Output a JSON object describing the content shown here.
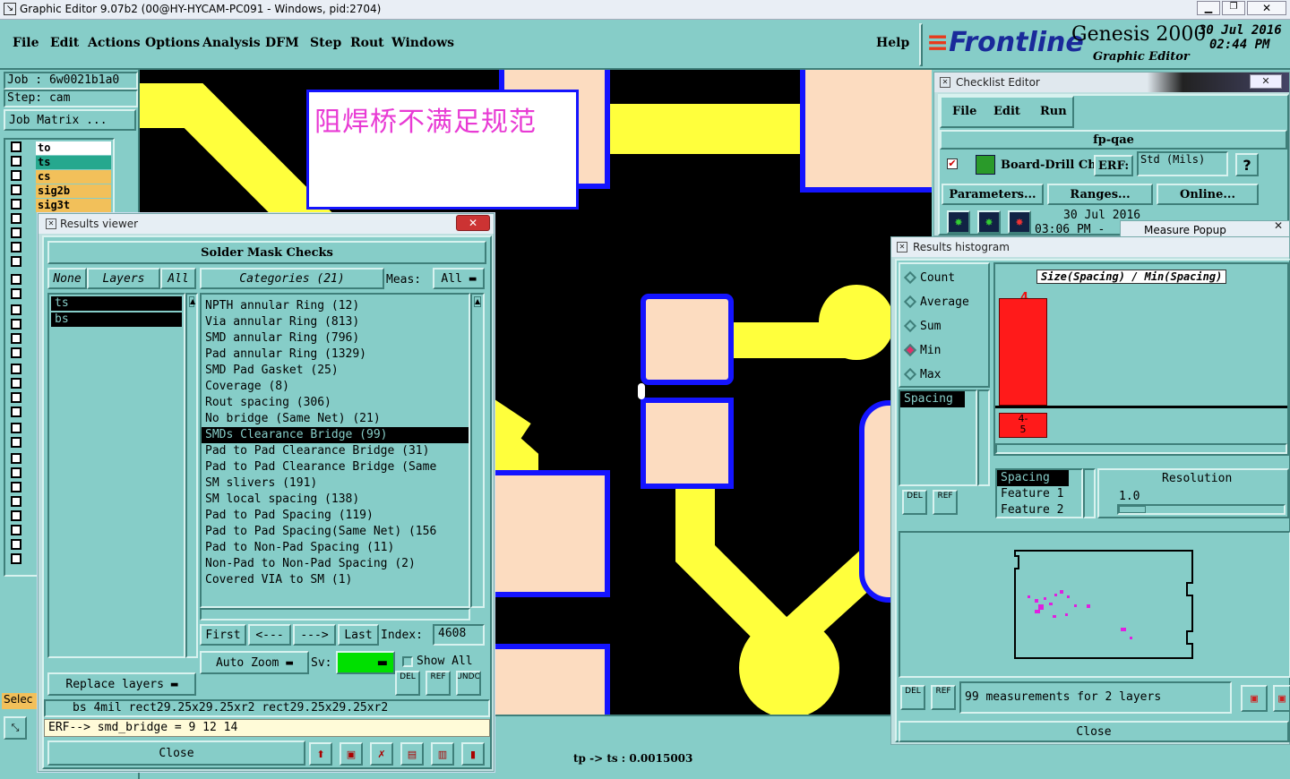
{
  "titlebar": {
    "title": "Graphic Editor 9.07b2 (00@HY-HYCAM-PC091 - Windows, pid:2704)"
  },
  "menu": {
    "items": [
      "File",
      "Edit",
      "Actions",
      "Options",
      "Analysis",
      "DFM",
      "Step",
      "Rout",
      "Windows"
    ],
    "help": "Help"
  },
  "brand": {
    "logo": "Frontline",
    "product": "Genesis 2000",
    "subtitle": "Graphic Editor",
    "date": "30 Jul 2016",
    "time": "02:44 PM"
  },
  "job": {
    "job_label": "Job  :  6w0021b1a0",
    "step_label": "Step: cam",
    "matrix_button": "Job Matrix ..."
  },
  "layers": [
    {
      "name": "to",
      "color": "#ffffff"
    },
    {
      "name": "ts",
      "color": "#26a88e"
    },
    {
      "name": "cs",
      "color": "#f2c05a"
    },
    {
      "name": "sig2b",
      "color": "#f2c05a"
    },
    {
      "name": "sig3t",
      "color": "#f2c05a"
    }
  ],
  "canvas": {
    "annotation": "阻焊桥不满足规范",
    "status": "tp -> ts : 0.0015003",
    "select_label": "Selec"
  },
  "results_viewer": {
    "title": "Results viewer",
    "header": "Solder Mask Checks",
    "none_btn": "None",
    "layers_btn": "Layers",
    "all_btn": "All",
    "categories_btn": "Categories (21)",
    "meas_label": "Meas:",
    "meas_value": "All",
    "layer_list": [
      "ts",
      "bs"
    ],
    "categories": [
      "NPTH annular Ring (12)",
      "Via annular Ring (813)",
      "SMD annular Ring (796)",
      "Pad annular Ring (1329)",
      "SMD Pad Gasket (25)",
      "Coverage (8)",
      "Rout spacing (306)",
      "No bridge (Same Net) (21)",
      "SMDs Clearance Bridge (99)",
      "Pad to Pad Clearance Bridge (31)",
      "Pad to Pad Clearance Bridge (Same",
      "SM slivers (191)",
      "SM local spacing (138)",
      "Pad to Pad Spacing (119)",
      "Pad to Pad Spacing(Same Net) (156",
      "Pad to Non-Pad Spacing (11)",
      "Non-Pad to Non-Pad Spacing (2)",
      "Covered VIA to SM (1)"
    ],
    "selected_index": 8,
    "nav": {
      "first": "First",
      "prev": "<---",
      "next": "--->",
      "last": "Last",
      "index_label": "Index:",
      "index_value": "4608"
    },
    "auto_zoom": "Auto Zoom",
    "sv_label": "Sv:",
    "show_all": "Show All",
    "replace_layers": "Replace layers",
    "small_btns": [
      "DEL",
      "REF",
      "UNDO"
    ],
    "info_line": "bs 4mil   rect29.25x29.25xr2   rect29.25x29.25xr2",
    "erf_line": "ERF--> smd_bridge = 9  12  14",
    "close": "Close"
  },
  "checklist": {
    "title": "Checklist Editor",
    "menu": [
      "File",
      "Edit",
      "Run"
    ],
    "name": "fp-qae",
    "row_label": "Board-Drill Che",
    "erf_label": "ERF:",
    "std_value": "Std (Mils)",
    "help": "?",
    "buttons": [
      "Parameters...",
      "Ranges...",
      "Online..."
    ],
    "date": "30 Jul 2016",
    "time": "03:06 PM -",
    "measure_popup": "Measure Popup"
  },
  "histogram": {
    "title": "Results histogram",
    "modes": [
      "Count",
      "Average",
      "Sum",
      "Min",
      "Max"
    ],
    "selected_mode": "Min",
    "axis_title": "Size(Spacing) / Min(Spacing)",
    "bar_value": "4",
    "bin_label": "4-\n5",
    "list_selected": "Spacing",
    "features": [
      "Spacing",
      "Feature 1",
      "Feature 2"
    ],
    "resolution_label": "Resolution",
    "resolution_value": "1.0",
    "small_btns": [
      "DEL",
      "REF"
    ],
    "summary": "99 measurements for 2 layers",
    "close": "Close",
    "chart_data": {
      "type": "bar",
      "categories": [
        "4-5"
      ],
      "values": [
        99
      ],
      "title": "Size(Spacing) / Min(Spacing)",
      "bar_color": "#ff1a1a"
    }
  },
  "colors": {
    "teal": "#86cdc8",
    "yellow": "#ffff3c",
    "pad": "#fcdcc0",
    "blue": "#1414ff",
    "canvas_bg": "#000000"
  }
}
